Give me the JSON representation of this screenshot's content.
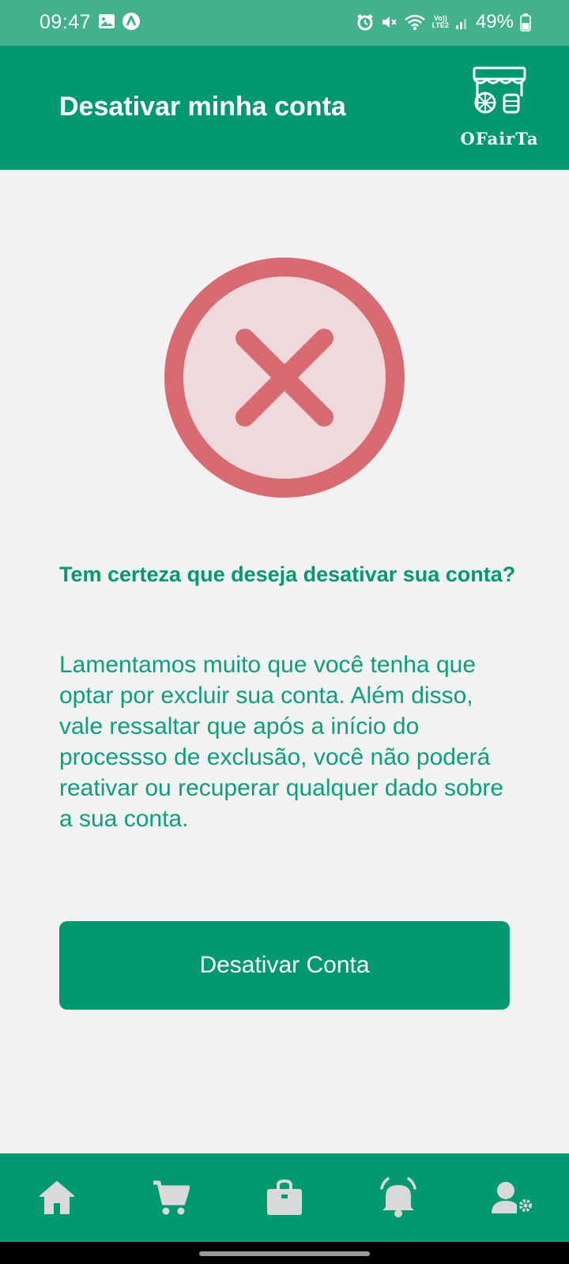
{
  "status_bar": {
    "time": "09:47",
    "lte_top": "Vo))",
    "lte_bottom": "LTE2",
    "battery": "49%"
  },
  "header": {
    "title": "Desativar minha conta",
    "brand": "OFairTa"
  },
  "icons": {
    "warning": "close-circle-icon",
    "nav": [
      "home-icon",
      "cart-icon",
      "shopping-bag-icon",
      "bell-icon",
      "user-settings-icon"
    ]
  },
  "content": {
    "question": "Tem certeza que deseja desativar sua conta?",
    "message": "Lamentamos muito que você tenha que optar por excluir sua conta. Além disso, vale ressaltar que após a início do processso de exclusão, você não poderá reativar ou recuperar qualquer dado sobre a sua conta.",
    "button_label": "Desativar Conta"
  },
  "colors": {
    "primary": "#009970",
    "status_bar": "#43b08e",
    "background": "#f2f2f2",
    "warning_ring": "#d86b72",
    "warning_fill": "#efd9db",
    "nav_icons": "#d9d9d9"
  }
}
